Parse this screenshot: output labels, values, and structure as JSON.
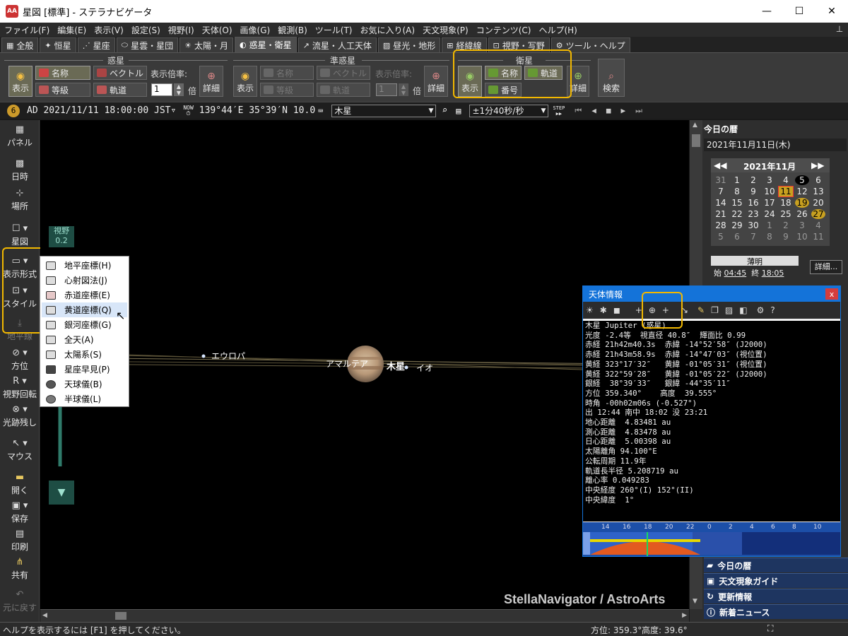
{
  "window": {
    "app_icon": "AA",
    "title": "星図 [標準] - ステラナビゲータ",
    "minimize": "—",
    "maximize": "☐",
    "close": "✕"
  },
  "menu": [
    "ファイル(F)",
    "編集(E)",
    "表示(V)",
    "設定(S)",
    "視野(I)",
    "天体(O)",
    "画像(G)",
    "観測(B)",
    "ツール(T)",
    "お気に入り(A)",
    "天文現象(P)",
    "コンテンツ(C)",
    "ヘルプ(H)"
  ],
  "tabs": [
    {
      "label": "全般",
      "icon": "grid-icon"
    },
    {
      "label": "恒星",
      "icon": "star-icon"
    },
    {
      "label": "星座",
      "icon": "constellation-icon"
    },
    {
      "label": "星雲・星団",
      "icon": "nebula-icon"
    },
    {
      "label": "太陽・月",
      "icon": "sun-icon"
    },
    {
      "label": "惑星・衛星",
      "icon": "planet-icon"
    },
    {
      "label": "流星・人工天体",
      "icon": "meteor-icon"
    },
    {
      "label": "昼光・地形",
      "icon": "landscape-icon"
    },
    {
      "label": "経緯線",
      "icon": "grid-lines-icon"
    },
    {
      "label": "視野・写野",
      "icon": "field-icon"
    },
    {
      "label": "ツール・ヘルプ",
      "icon": "gear-icon"
    }
  ],
  "ribbon": {
    "planets": {
      "title": "惑星",
      "show": "表示",
      "name": "名称",
      "vector": "ベクトル",
      "magnitude": "等級",
      "orbit": "軌道",
      "scale_label": "表示倍率:",
      "scale_value": "1",
      "scale_unit": "倍",
      "detail": "詳細"
    },
    "dwarf": {
      "title": "準惑星",
      "show": "表示",
      "name": "名称",
      "vector": "ベクトル",
      "magnitude": "等級",
      "orbit": "軌道",
      "scale_label": "表示倍率:",
      "scale_value": "1",
      "scale_unit": "倍",
      "detail": "詳細"
    },
    "satellites": {
      "title": "衛星",
      "show": "表示",
      "name": "名称",
      "orbit": "軌道",
      "number": "番号",
      "detail": "詳細"
    },
    "search": "検索"
  },
  "infobar": {
    "badge": "6",
    "datetime": "AD 2021/11/11 18:00:00 JST▿",
    "now": "NOW",
    "position": "139°44′E 35°39′N 10.0",
    "target": "木星",
    "speed": "±1分40秒/秒",
    "step": "STEP"
  },
  "leftbar": [
    {
      "label": "パネル",
      "icon": "panel-icon"
    },
    {
      "label": "日時",
      "icon": "calendar-icon"
    },
    {
      "label": "場所",
      "icon": "location-icon"
    },
    {
      "label": "星図",
      "icon": "map-icon"
    },
    {
      "label": "表示形式",
      "icon": "display-mode-icon"
    },
    {
      "label": "スタイル",
      "icon": "style-icon"
    },
    {
      "label": "地平線",
      "icon": "horizon-icon"
    },
    {
      "label": "方位",
      "icon": "compass-icon"
    },
    {
      "label": "視野回転",
      "icon": "rotate-icon"
    },
    {
      "label": "光跡残し",
      "icon": "trail-icon"
    },
    {
      "label": "マウス",
      "icon": "mouse-icon"
    },
    {
      "label": "開く",
      "icon": "folder-icon"
    },
    {
      "label": "保存",
      "icon": "save-icon"
    },
    {
      "label": "印刷",
      "icon": "print-icon"
    },
    {
      "label": "共有",
      "icon": "share-icon"
    },
    {
      "label": "元に戻す",
      "icon": "undo-icon"
    }
  ],
  "fov": {
    "label": "視野",
    "value": "0.2"
  },
  "popup_menu": [
    {
      "label": "地平座標(H)",
      "selected": false
    },
    {
      "label": "心射図法(J)",
      "selected": false
    },
    {
      "label": "赤道座標(E)",
      "selected": false
    },
    {
      "label": "黄道座標(Q)",
      "selected": true
    },
    {
      "label": "銀河座標(G)",
      "selected": false
    },
    {
      "label": "全天(A)",
      "selected": false
    },
    {
      "label": "太陽系(S)",
      "selected": false
    },
    {
      "label": "星座早見(P)",
      "selected": false
    },
    {
      "label": "天球儀(B)",
      "selected": false
    },
    {
      "label": "半球儀(L)",
      "selected": false
    }
  ],
  "sky": {
    "labels": {
      "europa": "エウロパ",
      "amalthea": "アマルテア",
      "jupiter": "木星",
      "io": "イオ"
    },
    "watermark": "StellaNavigator / AstroArts"
  },
  "info_window": {
    "title": "天体情報",
    "close": "x",
    "lines": [
      "木星 Jupiter (惑星)",
      "光度 -2.4等  視直径 40.8″  輝面比 0.99",
      "赤経 21h42m40.3s  赤緯 -14°52′58″ (J2000)",
      "赤経 21h43m58.9s  赤緯 -14°47′03″ (視位置)",
      "黄経 323°17′32″   黄緯 -01°05′31″ (視位置)",
      "黄経 322°59′28″   黄緯 -01°05′22″ (J2000)",
      "銀経  38°39′33″   銀緯 -44°35′11″",
      "方位 359.340°    高度  39.555°",
      "時角 -00h02m06s (-0.527°)",
      "出 12:44 南中 18:02 没 23:21",
      "地心距離  4.83481 au",
      "測心距離  4.83478 au",
      "日心距離  5.00398 au",
      "太陽離角 94.100°E",
      "公転周期 11.9年",
      "軌道長半径 5.208719 au",
      "離心率 0.049283",
      "中央経度 260°(I) 152°(II)",
      "中央緯度  1°"
    ],
    "timeline_hours": [
      "14",
      "16",
      "18",
      "20",
      "22",
      "0",
      "2",
      "4",
      "6",
      "8",
      "10"
    ]
  },
  "right_panel": {
    "header": "今日の暦",
    "date": "2021年11月11日(木)",
    "month": "2021年11月",
    "calendar": [
      [
        "31",
        "1",
        "2",
        "3",
        "4",
        "5",
        "6"
      ],
      [
        "7",
        "8",
        "9",
        "10",
        "11",
        "12",
        "13"
      ],
      [
        "14",
        "15",
        "16",
        "17",
        "18",
        "19",
        "20"
      ],
      [
        "21",
        "22",
        "23",
        "24",
        "25",
        "26",
        "27"
      ],
      [
        "28",
        "29",
        "30",
        "1",
        "2",
        "3",
        "4"
      ],
      [
        "5",
        "6",
        "7",
        "8",
        "9",
        "10",
        "11"
      ]
    ],
    "twilight": "薄明",
    "start_label": "始",
    "start_time": "04:45",
    "end_label": "終",
    "end_time": "18:05",
    "detail": "詳細...",
    "links": [
      "今日の暦",
      "天文現象ガイド",
      "更新情報",
      "新着ニュース"
    ]
  },
  "status": {
    "help": "ヘルプを表示するには [F1] を押してください。",
    "azimuth": "方位: 359.3°",
    "altitude": "高度:  39.6°"
  }
}
